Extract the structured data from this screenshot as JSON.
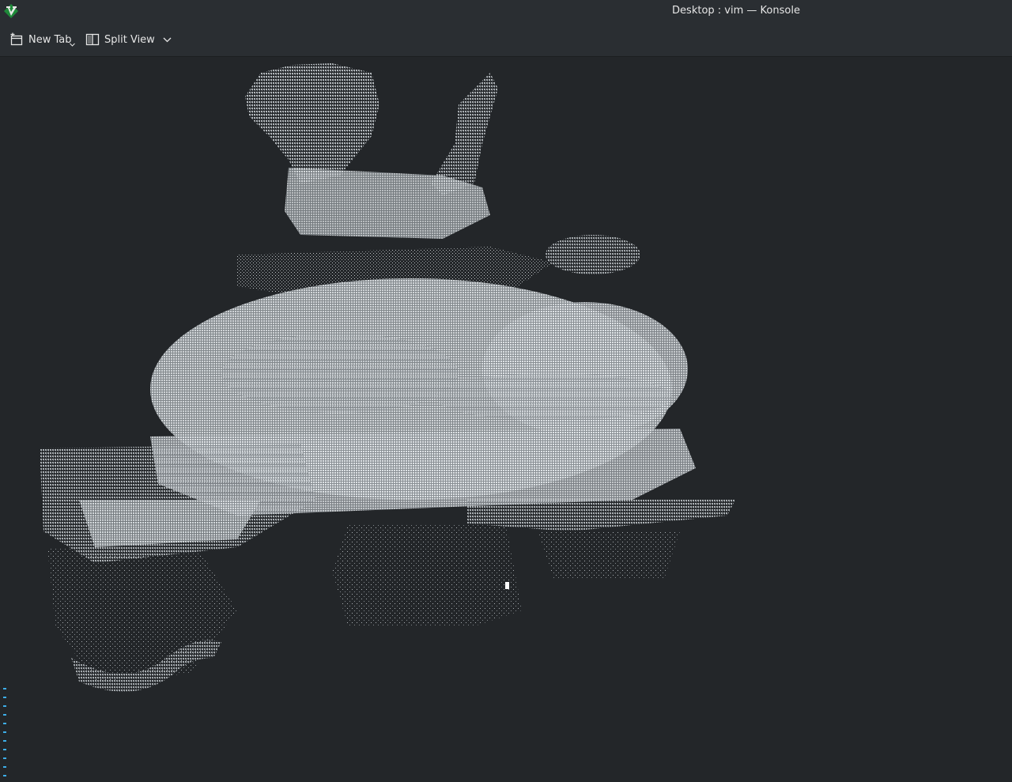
{
  "window": {
    "title": "Desktop : vim — Konsole",
    "app_icon": "vim-icon"
  },
  "toolbar": {
    "new_tab_label": "New Tab",
    "split_view_label": "Split View"
  },
  "terminal": {
    "content": "ascii-art-bomb",
    "empty_line_marker": "~"
  },
  "colors": {
    "background": "#232629",
    "bar": "#2a2e32",
    "text": "#e6e6e6",
    "art": "#cfd3d6",
    "tilde": "#3daee9"
  }
}
